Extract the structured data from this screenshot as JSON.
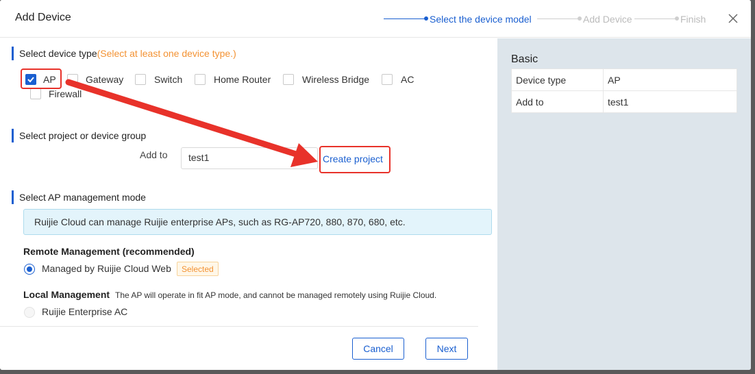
{
  "dialog": {
    "title": "Add Device",
    "steps": [
      {
        "label": "Select the device model",
        "state": "active"
      },
      {
        "label": "Add Device",
        "state": "pending"
      },
      {
        "label": "Finish",
        "state": "pending"
      }
    ]
  },
  "device_type": {
    "title": "Select device type",
    "hint": "(Select at least one device type.)",
    "options": [
      {
        "label": "AP",
        "checked": true
      },
      {
        "label": "Gateway",
        "checked": false
      },
      {
        "label": "Switch",
        "checked": false
      },
      {
        "label": "Home Router",
        "checked": false
      },
      {
        "label": "Wireless Bridge",
        "checked": false
      },
      {
        "label": "AC",
        "checked": false
      },
      {
        "label": "Firewall",
        "checked": false
      }
    ]
  },
  "project": {
    "title": "Select project or device group",
    "add_to_label": "Add to",
    "add_to_value": "test1",
    "create_link": "Create project"
  },
  "ap_mode": {
    "title": "Select AP management mode",
    "info": "Ruijie Cloud can manage Ruijie enterprise APs, such as RG-AP720, 880, 870, 680, etc.",
    "remote_title": "Remote Management (recommended)",
    "remote_option": "Managed by Ruijie Cloud Web",
    "selected_badge": "Selected",
    "local_title": "Local Management",
    "local_desc": "The AP will operate in fit AP mode, and cannot be managed remotely using Ruijie Cloud.",
    "local_option": "Ruijie Enterprise AC"
  },
  "footer": {
    "cancel_label": "Cancel",
    "next_label": "Next"
  },
  "basic": {
    "title": "Basic",
    "rows": [
      {
        "key": "Device type",
        "value": "AP"
      },
      {
        "key": "Add to",
        "value": "test1"
      }
    ]
  },
  "colors": {
    "accent": "#1a5fd0",
    "warning": "#f39233",
    "annotation": "#e8322a",
    "inactive_step": "#bbbbbb"
  }
}
